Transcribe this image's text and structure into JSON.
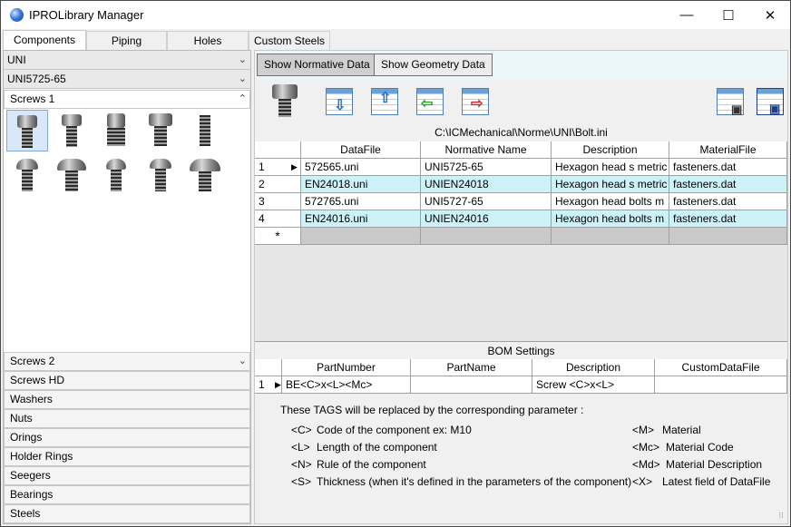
{
  "window": {
    "title": "IPROLibrary Manager",
    "minimize_glyph": "—",
    "maximize_glyph": "☐",
    "close_glyph": "✕"
  },
  "tabs": [
    {
      "label": "Components",
      "active": true
    },
    {
      "label": "Piping",
      "active": false
    },
    {
      "label": "Holes",
      "active": false
    },
    {
      "label": "Custom Steels",
      "active": false
    }
  ],
  "left": {
    "combo1": "UNI",
    "combo2": "UNI5725-65",
    "groups_top": [
      "Screws 1"
    ],
    "groups_bottom": [
      "Screws 2",
      "Screws HD",
      "Washers",
      "Nuts",
      "Orings",
      "Holder Rings",
      "Seegers",
      "Bearings",
      "Steels"
    ]
  },
  "right": {
    "toggle_normative": "Show Normative Data",
    "toggle_geometry": "Show Geometry Data",
    "file_path": "C:\\ICMechanical\\Norme\\UNI\\Bolt.ini",
    "columns": [
      "DataFile",
      "Normative Name",
      "Description",
      "MaterialFile"
    ],
    "rows": [
      {
        "n": "1",
        "datafile": "572565.uni",
        "name": "UNI5725-65",
        "desc": "Hexagon head s metric",
        "mat": "fasteners.dat",
        "current": true
      },
      {
        "n": "2",
        "datafile": "EN24018.uni",
        "name": "UNIEN24018",
        "desc": "Hexagon head s metric",
        "mat": "fasteners.dat",
        "current": false
      },
      {
        "n": "3",
        "datafile": "572765.uni",
        "name": "UNI5727-65",
        "desc": "Hexagon head bolts  m",
        "mat": "fasteners.dat",
        "current": false
      },
      {
        "n": "4",
        "datafile": "EN24016.uni",
        "name": "UNIEN24016",
        "desc": "Hexagon head bolts  m",
        "mat": "fasteners.dat",
        "current": false
      }
    ],
    "new_row_marker": "*",
    "current_row_marker": "▶",
    "bom_title": "BOM Settings",
    "bom_columns": [
      "PartNumber",
      "PartName",
      "Description",
      "CustomDataFile"
    ],
    "bom_row": {
      "n": "1",
      "partnumber": "BE<C>x<L><Mc>",
      "partname": "",
      "desc": "Screw <C>x<L>",
      "custom": ""
    },
    "tags_intro": "These TAGS will be replaced by the corresponding parameter :",
    "tags_left": [
      {
        "tag": "<C>",
        "text": "Code of the component ex: M10"
      },
      {
        "tag": "<L>",
        "text": "Length of the component"
      },
      {
        "tag": "<N>",
        "text": "Rule of the component"
      },
      {
        "tag": "<S>",
        "text": "Thickness (when it's defined in the parameters of the component)"
      }
    ],
    "tags_right": [
      {
        "tag": "<M>",
        "text": "Material"
      },
      {
        "tag": "<Mc>",
        "text": "Material Code"
      },
      {
        "tag": "<Md>",
        "text": "Material Description"
      },
      {
        "tag": "<X>",
        "text": "Latest field of DataFile"
      }
    ]
  },
  "colors": {
    "alt_row": "#ccf2f8",
    "toggle_bar": "#ebf6fb",
    "selected_thumb": "#d9e8f8"
  }
}
